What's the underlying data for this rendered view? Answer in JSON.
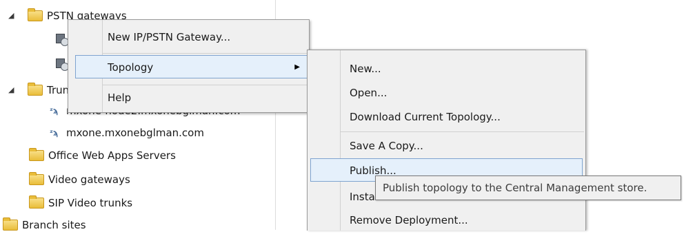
{
  "tree": {
    "items": [
      {
        "label": "PSTN gateways"
      },
      {
        "label": "Trunks"
      },
      {
        "label": "mxone-node2.mxonebglman.com"
      },
      {
        "label": "mxone.mxonebglman.com"
      },
      {
        "label": "Office Web Apps Servers"
      },
      {
        "label": "Video gateways"
      },
      {
        "label": "SIP Video trunks"
      },
      {
        "label": "Branch sites"
      }
    ]
  },
  "context_menu": {
    "items": [
      {
        "label": "New IP/PSTN Gateway..."
      },
      {
        "label": "Topology"
      },
      {
        "label": "Help"
      }
    ]
  },
  "topology_submenu": {
    "items": [
      {
        "label": "New..."
      },
      {
        "label": "Open..."
      },
      {
        "label": "Download Current Topology..."
      },
      {
        "label": "Save A Copy..."
      },
      {
        "label": "Publish..."
      },
      {
        "label": "Install Database..."
      },
      {
        "label": "Remove Deployment..."
      }
    ]
  },
  "tooltip": {
    "text": "Publish topology to the Central Management store."
  }
}
